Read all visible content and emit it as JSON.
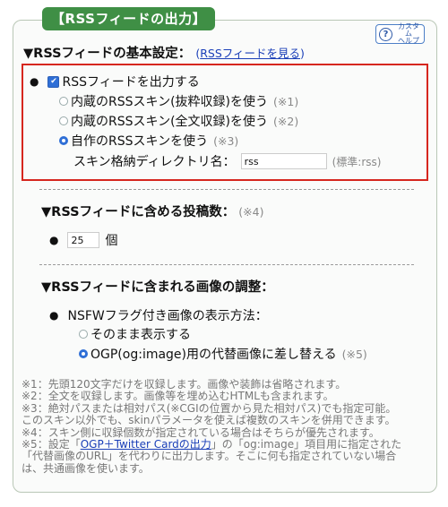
{
  "panel": {
    "legend": "【RSSフィードの出力】",
    "help": {
      "line1": "カスタム",
      "line2": "ヘルプ"
    }
  },
  "basic": {
    "title": "▼RSSフィードの基本設定：",
    "link_open": "(",
    "link_label": "RSSフィードを見る",
    "link_close": ")",
    "output_label": "RSSフィードを出力する",
    "options": [
      {
        "label": "内蔵のRSSスキン(抜粋収録)を使う",
        "note": "(※1)",
        "selected": false
      },
      {
        "label": "内蔵のRSSスキン(全文収録)を使う",
        "note": "(※2)",
        "selected": false
      },
      {
        "label": "自作のRSSスキンを使う",
        "note": "(※3)",
        "selected": true
      }
    ],
    "dir_label": "スキン格納ディレクトリ名：",
    "dir_value": "rss",
    "dir_default": "(標準:rss)"
  },
  "count": {
    "title": "▼RSSフィードに含める投稿数：",
    "note": "(※4)",
    "value": "25",
    "unit": "個"
  },
  "images": {
    "title": "▼RSSフィードに含まれる画像の調整：",
    "nsfw_label": "NSFWフラグ付き画像の表示方法：",
    "options": [
      {
        "label": "そのまま表示する",
        "note": "",
        "selected": false
      },
      {
        "label": "OGP(og:image)用の代替画像に差し替える",
        "note": "(※5)",
        "selected": true
      }
    ]
  },
  "footnotes": {
    "n1": "※1：先頭120文字だけを収録します。画像や装飾は省略されます。",
    "n2": "※2：全文を収録します。画像等を埋め込むHTMLも含まれます。",
    "n3a": "※3：絶対パスまたは相対パス(※CGIの位置から見た相対パス)でも指定可能。",
    "n3b": "このスキン以外でも、skinパラメータを使えば複数のスキンを併用できます。",
    "n4": "※4：スキン側に収録個数が指定されている場合はそちらが優先されます。",
    "n5_pre": "※5：設定「",
    "n5_link": "OGP＋Twitter Cardの出力",
    "n5_post": "」の「og:image」項目用に指定された",
    "n5b": "「代替画像のURL」を代わりに出力します。そこに何も指定されていない場合",
    "n5c": "は、共通画像を使います。"
  },
  "colors": {
    "accent": "#3f8f45",
    "highlight_border": "#d6261e",
    "link": "#1a3fb8"
  }
}
